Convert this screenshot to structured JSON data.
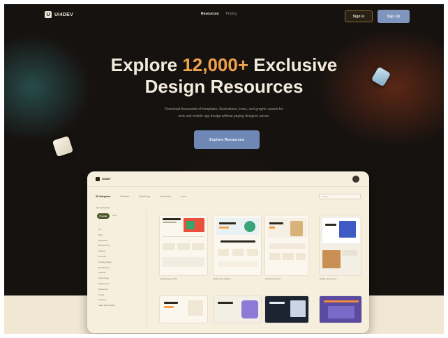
{
  "brand": {
    "name": "UI4DEV"
  },
  "nav": {
    "links": [
      "Resources",
      "Pricing"
    ],
    "sign_in": "Sign in",
    "sign_up": "Sign Up"
  },
  "hero": {
    "title_pre": "Explore ",
    "title_accent": "12,000+",
    "title_post": " Exclusive",
    "title_line2": "Design Resources",
    "subtitle_line1": "Download thousands of templates, illustrations, icons, and graphic assets for",
    "subtitle_line2": "web and mobile app design without paying designer prices.",
    "cta": "Explore Resources"
  },
  "mockup": {
    "brand": "UI4DEV",
    "tabs": [
      "All Categories",
      "Websites",
      "Mobile App",
      "Dashboard",
      "Icons"
    ],
    "search_placeholder": "Search",
    "filter_label": "Sort by Popular",
    "pill_active": "Popular",
    "pill_other": "New",
    "sidebar": [
      "All",
      "Blog",
      "Education",
      "Ecommerce",
      "Agency",
      "Portfolio",
      "Landing Page",
      "Real Estate",
      "Medical",
      "Technology",
      "Restaurant",
      "Marketing",
      "Travel",
      "Finance",
      "Saas Web Design"
    ],
    "captions": [
      "Landing page UI Kit",
      "Real estate website",
      "Furniture store UI",
      "Mobile app screens"
    ]
  },
  "colors": {
    "accent": "#f2a24a",
    "button": "#7f95bd",
    "background": "#161210",
    "cream": "#f6efde"
  }
}
